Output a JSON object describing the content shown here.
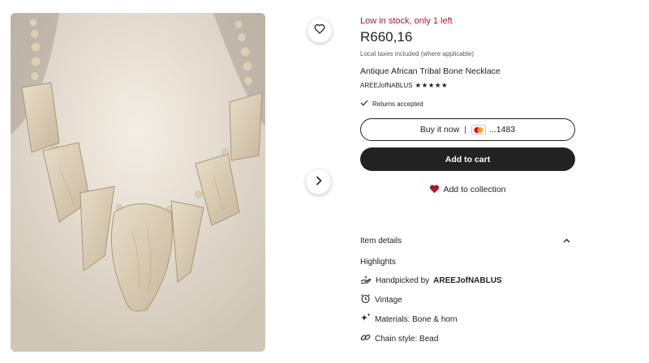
{
  "gallery": {
    "favorite_icon": "heart-outline-icon",
    "next_icon": "chevron-right-icon",
    "photo_subject": "bone-necklace-photo"
  },
  "listing": {
    "stock_text": "Low in stock, only 1 left",
    "price": "R660,16",
    "taxes_note": "Local taxes included (where applicable)",
    "title": "Antique African Tribal Bone Necklace",
    "shop_name": "AREEJofNABLUS",
    "rating_stars": "★★★★★",
    "rating": 5,
    "returns_text": "Returns accepted",
    "colors": {
      "stock": "#a61a2e",
      "primary_button": "#222222",
      "heart": "#a61a2e"
    }
  },
  "actions": {
    "buy_now_label": "Buy it now",
    "buy_now_separator": "|",
    "card_suffix": "...1483",
    "card_icon": "mastercard-icon",
    "add_to_cart_label": "Add to cart",
    "add_to_collection_label": "Add to collection",
    "add_to_collection_icon": "heart-filled-icon"
  },
  "details": {
    "section_label": "Item details",
    "section_icon": "chevron-up-icon",
    "highlights_label": "Highlights",
    "handpicked_prefix": "Handpicked by",
    "handpicked_shop": "AREEJofNABLUS",
    "vintage": "Vintage",
    "materials": "Materials: Bone & horn",
    "chain_style": "Chain style: Bead"
  }
}
